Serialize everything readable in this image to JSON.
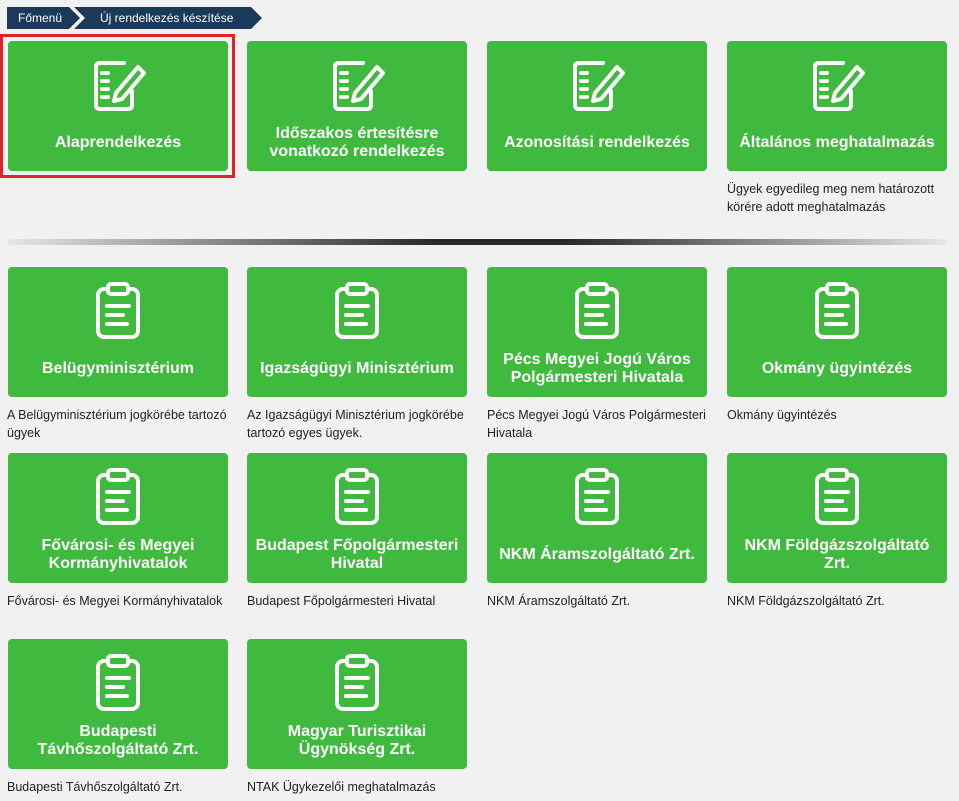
{
  "breadcrumb": {
    "home": "Főmenü",
    "current": "Új rendelkezés készítése"
  },
  "top_tiles": [
    {
      "label": "Alaprendelkezés",
      "description": ""
    },
    {
      "label": "Időszakos értesítésre vonatkozó rendelkezés",
      "description": ""
    },
    {
      "label": "Azonosítási rendelkezés",
      "description": ""
    },
    {
      "label": "Általános meghatalmazás",
      "description": "Ügyek egyedileg meg nem határozott körére adott meghatalmazás"
    }
  ],
  "org_tiles": [
    {
      "label": "Belügyminisztérium",
      "description": "A Belügyminisztérium jogkörébe tartozó ügyek"
    },
    {
      "label": "Igazságügyi Minisztérium",
      "description": "Az Igazságügyi Minisztérium jogkörébe tartozó egyes ügyek."
    },
    {
      "label": "Pécs Megyei Jogú Város Polgármesteri Hivatala",
      "description": "Pécs Megyei Jogú Város Polgármesteri Hivatala"
    },
    {
      "label": "Okmány ügyintézés",
      "description": "Okmány ügyintézés"
    },
    {
      "label": "Fővárosi- és Megyei Kormányhivatalok",
      "description": "Fővárosi- és Megyei Kormányhivatalok"
    },
    {
      "label": "Budapest Főpolgármesteri Hivatal",
      "description": "Budapest Főpolgármesteri Hivatal"
    },
    {
      "label": "NKM Áramszolgáltató Zrt.",
      "description": "NKM Áramszolgáltató Zrt."
    },
    {
      "label": "NKM Földgázszolgáltató Zrt.",
      "description": "NKM Földgázszolgáltató Zrt."
    },
    {
      "label": "Budapesti Távhőszolgáltató Zrt.",
      "description": "Budapesti Távhőszolgáltató Zrt."
    },
    {
      "label": "Magyar Turisztikai Ügynökség Zrt.",
      "description": "NTAK Ügykezelői meghatalmazás"
    }
  ],
  "icons": {
    "top": "notepad-pencil-icon",
    "org": "clipboard-icon"
  },
  "colors": {
    "tile": "#3fba3f",
    "breadcrumb": "#1b3a5a",
    "selection": "#e1232b"
  }
}
